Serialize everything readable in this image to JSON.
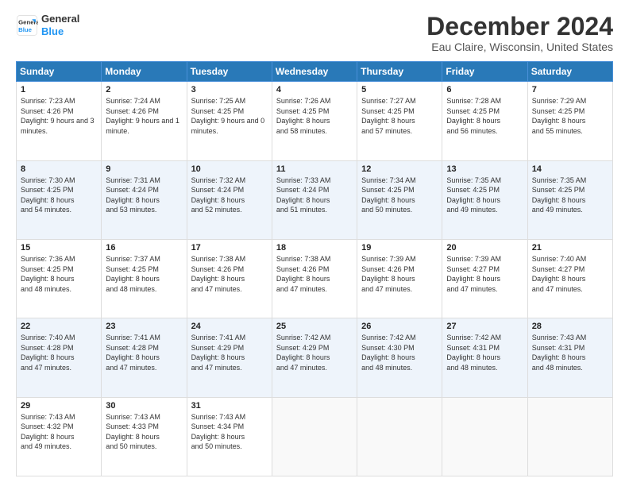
{
  "logo": {
    "line1": "General",
    "line2": "Blue"
  },
  "title": "December 2024",
  "subtitle": "Eau Claire, Wisconsin, United States",
  "days_of_week": [
    "Sunday",
    "Monday",
    "Tuesday",
    "Wednesday",
    "Thursday",
    "Friday",
    "Saturday"
  ],
  "weeks": [
    [
      {
        "day": "1",
        "sunrise": "7:23 AM",
        "sunset": "4:26 PM",
        "daylight": "9 hours and 3 minutes."
      },
      {
        "day": "2",
        "sunrise": "7:24 AM",
        "sunset": "4:26 PM",
        "daylight": "9 hours and 1 minute."
      },
      {
        "day": "3",
        "sunrise": "7:25 AM",
        "sunset": "4:25 PM",
        "daylight": "9 hours and 0 minutes."
      },
      {
        "day": "4",
        "sunrise": "7:26 AM",
        "sunset": "4:25 PM",
        "daylight": "8 hours and 58 minutes."
      },
      {
        "day": "5",
        "sunrise": "7:27 AM",
        "sunset": "4:25 PM",
        "daylight": "8 hours and 57 minutes."
      },
      {
        "day": "6",
        "sunrise": "7:28 AM",
        "sunset": "4:25 PM",
        "daylight": "8 hours and 56 minutes."
      },
      {
        "day": "7",
        "sunrise": "7:29 AM",
        "sunset": "4:25 PM",
        "daylight": "8 hours and 55 minutes."
      }
    ],
    [
      {
        "day": "8",
        "sunrise": "7:30 AM",
        "sunset": "4:25 PM",
        "daylight": "8 hours and 54 minutes."
      },
      {
        "day": "9",
        "sunrise": "7:31 AM",
        "sunset": "4:24 PM",
        "daylight": "8 hours and 53 minutes."
      },
      {
        "day": "10",
        "sunrise": "7:32 AM",
        "sunset": "4:24 PM",
        "daylight": "8 hours and 52 minutes."
      },
      {
        "day": "11",
        "sunrise": "7:33 AM",
        "sunset": "4:24 PM",
        "daylight": "8 hours and 51 minutes."
      },
      {
        "day": "12",
        "sunrise": "7:34 AM",
        "sunset": "4:25 PM",
        "daylight": "8 hours and 50 minutes."
      },
      {
        "day": "13",
        "sunrise": "7:35 AM",
        "sunset": "4:25 PM",
        "daylight": "8 hours and 49 minutes."
      },
      {
        "day": "14",
        "sunrise": "7:35 AM",
        "sunset": "4:25 PM",
        "daylight": "8 hours and 49 minutes."
      }
    ],
    [
      {
        "day": "15",
        "sunrise": "7:36 AM",
        "sunset": "4:25 PM",
        "daylight": "8 hours and 48 minutes."
      },
      {
        "day": "16",
        "sunrise": "7:37 AM",
        "sunset": "4:25 PM",
        "daylight": "8 hours and 48 minutes."
      },
      {
        "day": "17",
        "sunrise": "7:38 AM",
        "sunset": "4:26 PM",
        "daylight": "8 hours and 47 minutes."
      },
      {
        "day": "18",
        "sunrise": "7:38 AM",
        "sunset": "4:26 PM",
        "daylight": "8 hours and 47 minutes."
      },
      {
        "day": "19",
        "sunrise": "7:39 AM",
        "sunset": "4:26 PM",
        "daylight": "8 hours and 47 minutes."
      },
      {
        "day": "20",
        "sunrise": "7:39 AM",
        "sunset": "4:27 PM",
        "daylight": "8 hours and 47 minutes."
      },
      {
        "day": "21",
        "sunrise": "7:40 AM",
        "sunset": "4:27 PM",
        "daylight": "8 hours and 47 minutes."
      }
    ],
    [
      {
        "day": "22",
        "sunrise": "7:40 AM",
        "sunset": "4:28 PM",
        "daylight": "8 hours and 47 minutes."
      },
      {
        "day": "23",
        "sunrise": "7:41 AM",
        "sunset": "4:28 PM",
        "daylight": "8 hours and 47 minutes."
      },
      {
        "day": "24",
        "sunrise": "7:41 AM",
        "sunset": "4:29 PM",
        "daylight": "8 hours and 47 minutes."
      },
      {
        "day": "25",
        "sunrise": "7:42 AM",
        "sunset": "4:29 PM",
        "daylight": "8 hours and 47 minutes."
      },
      {
        "day": "26",
        "sunrise": "7:42 AM",
        "sunset": "4:30 PM",
        "daylight": "8 hours and 48 minutes."
      },
      {
        "day": "27",
        "sunrise": "7:42 AM",
        "sunset": "4:31 PM",
        "daylight": "8 hours and 48 minutes."
      },
      {
        "day": "28",
        "sunrise": "7:43 AM",
        "sunset": "4:31 PM",
        "daylight": "8 hours and 48 minutes."
      }
    ],
    [
      {
        "day": "29",
        "sunrise": "7:43 AM",
        "sunset": "4:32 PM",
        "daylight": "8 hours and 49 minutes."
      },
      {
        "day": "30",
        "sunrise": "7:43 AM",
        "sunset": "4:33 PM",
        "daylight": "8 hours and 50 minutes."
      },
      {
        "day": "31",
        "sunrise": "7:43 AM",
        "sunset": "4:34 PM",
        "daylight": "8 hours and 50 minutes."
      },
      null,
      null,
      null,
      null
    ]
  ]
}
